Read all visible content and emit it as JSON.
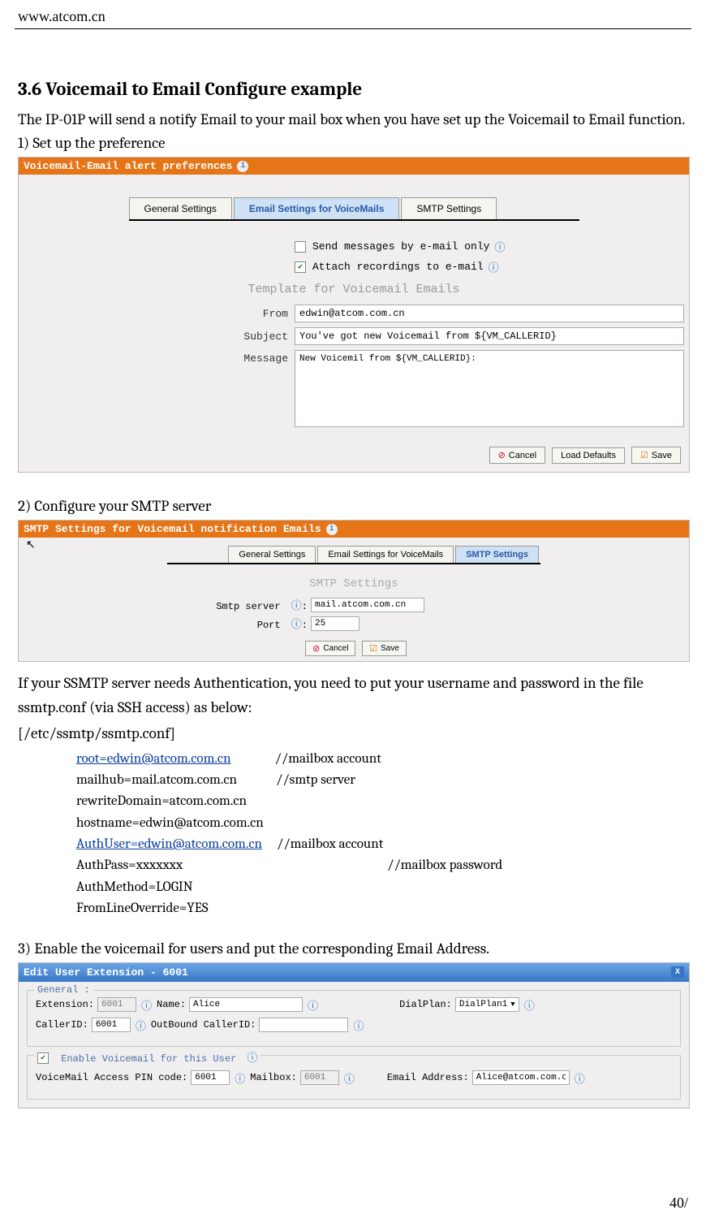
{
  "header": {
    "url": "www.atcom.cn"
  },
  "section": {
    "number": "3.6",
    "title": "Voicemail to Email Configure example",
    "intro": "The IP-01P will send a notify Email to your mail box when you have set up the Voicemail to Email function.",
    "step1": "1)   Set up the preference",
    "step2": "2)   Configure your SMTP server",
    "step3": "3)   Enable the voicemail for users and put the corresponding Email Address.",
    "auth_text": "If your SSMTP server needs Authentication, you need to put your username and password in the file ssmtp.conf (via SSH access) as below:",
    "conf_path": "[/etc/ssmtp/ssmtp.conf]"
  },
  "panel1": {
    "bar_title": "Voicemail-Email alert preferences",
    "tab_general": "General Settings",
    "tab_email": "Email Settings for VoiceMails",
    "tab_smtp": "SMTP Settings",
    "cb1_label": "Send messages by e-mail only",
    "cb2_label": "Attach recordings to e-mail",
    "template_title": "Template for Voicemail Emails",
    "from_label": "From",
    "from_value": "edwin@atcom.com.cn",
    "subject_label": "Subject",
    "subject_value": "You've got new Voicemail from ${VM_CALLERID}",
    "message_label": "Message",
    "message_value": "New Voicemil from ${VM_CALLERID}:",
    "btn_cancel": "Cancel",
    "btn_defaults": "Load Defaults",
    "btn_save": "Save"
  },
  "panel2": {
    "bar_title": "SMTP Settings for Voicemail notification Emails",
    "tab_general": "General Settings",
    "tab_email": "Email Settings for VoiceMails",
    "tab_smtp": "SMTP Settings",
    "smtp_title": "SMTP Settings",
    "server_label": "Smtp server",
    "server_value": "mail.atcom.com.cn",
    "port_label": "Port",
    "port_value": "25",
    "btn_cancel": "Cancel",
    "btn_save": "Save"
  },
  "conf": {
    "l1a": "root=edwin@atcom.com.cn",
    "l1b": "//mailbox account",
    "l2a": "mailhub=mail.atcom.com.cn",
    "l2b": "//smtp server",
    "l3": "rewriteDomain=atcom.com.cn",
    "l4": "hostname=edwin@atcom.com.cn",
    "l5a": "AuthUser=edwin@atcom.com.cn",
    "l5b": "//mailbox account",
    "l6a": "AuthPass=xxxxxxx",
    "l6b": "//mailbox password",
    "l7": "AuthMethod=LOGIN",
    "l8": "FromLineOverride=YES"
  },
  "panel3": {
    "bar_title": "Edit User Extension - 6001",
    "legend_general": "General :",
    "ext_label": "Extension:",
    "ext_value": "6001",
    "name_label": "Name:",
    "name_value": "Alice",
    "dialplan_label": "DialPlan:",
    "dialplan_value": "DialPlan1",
    "callerid_label": "CallerID:",
    "callerid_value": "6001",
    "outbound_label": "OutBound CallerID:",
    "outbound_value": "",
    "enable_vm_label": "Enable Voicemail for this User",
    "pin_label": "VoiceMail Access PIN code:",
    "pin_value": "6001",
    "mailbox_label": "Mailbox:",
    "mailbox_value": "6001",
    "email_label": "Email Address:",
    "email_value": "Alice@atcom.com.c"
  },
  "page_number": "40/"
}
